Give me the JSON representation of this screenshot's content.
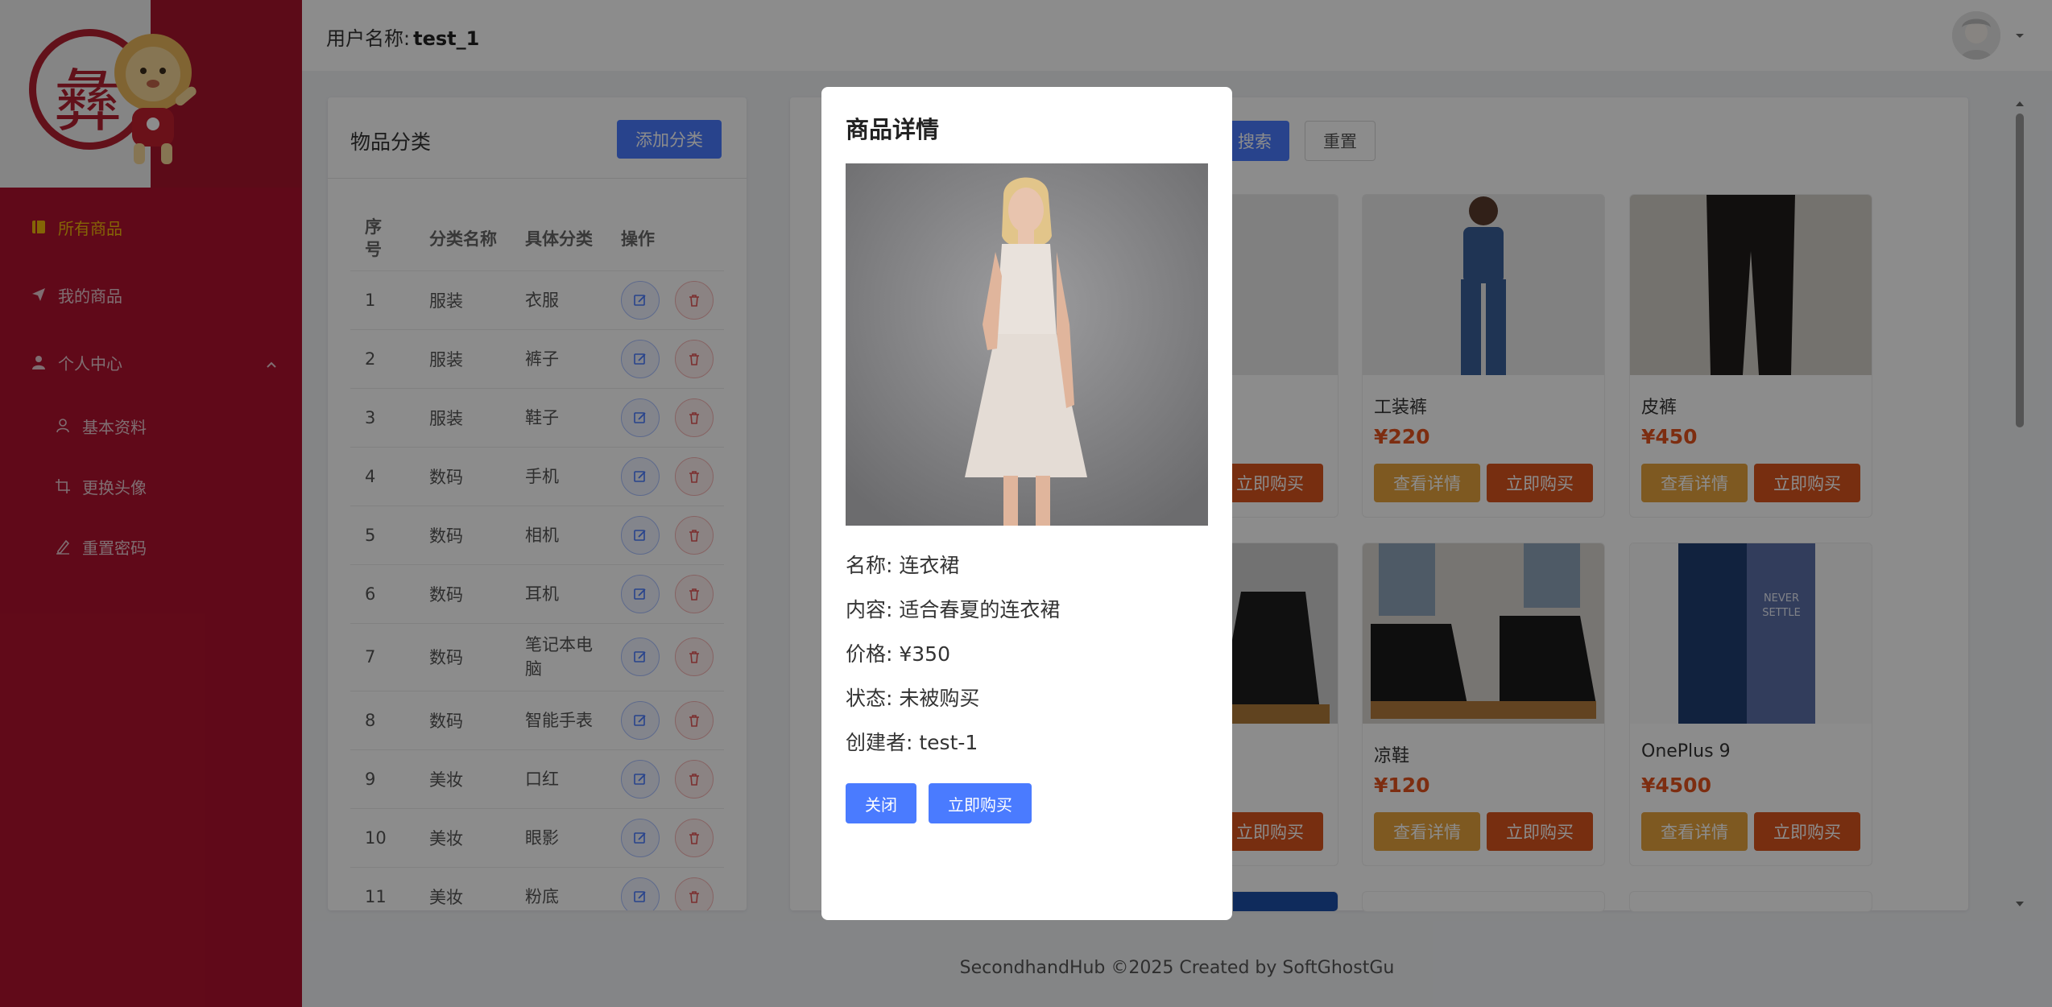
{
  "header": {
    "user_label": "用户名称:",
    "user_name": "test_1"
  },
  "sidebar": {
    "items": [
      {
        "label": "所有商品",
        "icon": "book-icon"
      },
      {
        "label": "我的商品",
        "icon": "send-icon"
      },
      {
        "label": "个人中心",
        "icon": "user-icon"
      },
      {
        "label": "基本资料",
        "icon": "user-outline-icon"
      },
      {
        "label": "更换头像",
        "icon": "crop-icon"
      },
      {
        "label": "重置密码",
        "icon": "pen-icon"
      }
    ],
    "active_color": "#f0b90b"
  },
  "categories": {
    "title": "物品分类",
    "add_button": "添加分类",
    "headers": {
      "index": "序号",
      "name": "分类名称",
      "detail": "具体分类",
      "actions": "操作"
    },
    "rows": [
      {
        "index": "1",
        "name": "服装",
        "detail": "衣服"
      },
      {
        "index": "2",
        "name": "服装",
        "detail": "裤子"
      },
      {
        "index": "3",
        "name": "服装",
        "detail": "鞋子"
      },
      {
        "index": "4",
        "name": "数码",
        "detail": "手机"
      },
      {
        "index": "5",
        "name": "数码",
        "detail": "相机"
      },
      {
        "index": "6",
        "name": "数码",
        "detail": "耳机"
      },
      {
        "index": "7",
        "name": "数码",
        "detail": "笔记本电脑"
      },
      {
        "index": "8",
        "name": "数码",
        "detail": "智能手表"
      },
      {
        "index": "9",
        "name": "美妆",
        "detail": "口红"
      },
      {
        "index": "10",
        "name": "美妆",
        "detail": "眼影"
      },
      {
        "index": "11",
        "name": "美妆",
        "detail": "粉底"
      }
    ]
  },
  "products": {
    "search_button": "搜索",
    "reset_button": "重置",
    "detail_button": "查看详情",
    "buy_button": "立即购买",
    "items": [
      {
        "name": "工装裤",
        "price": "¥220"
      },
      {
        "name": "皮裤",
        "price": "¥450"
      },
      {
        "name": "凉鞋",
        "price": "¥120"
      },
      {
        "name": "OnePlus 9",
        "price": "¥4500"
      }
    ]
  },
  "modal": {
    "title": "商品详情",
    "name_line": "名称: 连衣裙",
    "content_line": "内容: 适合春夏的连衣裙",
    "price_line": "价格: ¥350",
    "status_line": "状态: 未被购买",
    "creator_line": "创建者: test-1",
    "close_button": "关闭",
    "buy_button": "立即购买"
  },
  "footer": {
    "text": "SecondhandHub ©2025 Created by SoftGhostGu"
  },
  "colors": {
    "sidebar_bg": "#b0122e",
    "primary": "#4a7bff",
    "warn": "#e6a23c",
    "danger": "#d9541e"
  }
}
